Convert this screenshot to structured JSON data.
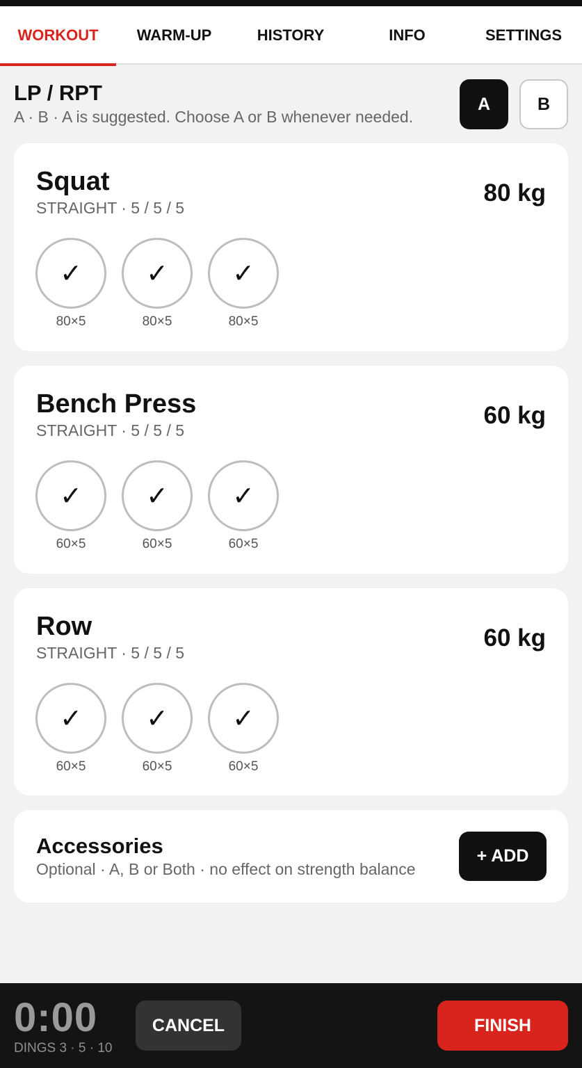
{
  "tabs": [
    {
      "label": "WORKOUT",
      "active": true
    },
    {
      "label": "WARM-UP",
      "active": false
    },
    {
      "label": "HISTORY",
      "active": false
    },
    {
      "label": "INFO",
      "active": false
    },
    {
      "label": "SETTINGS",
      "active": false
    }
  ],
  "program": {
    "title": "LP / RPT",
    "subtitle": "A · B · A is suggested. Choose A or B whenever needed.",
    "option_a": "A",
    "option_b": "B",
    "selected": "A"
  },
  "exercises": [
    {
      "name": "Squat",
      "scheme": "STRAIGHT · 5 / 5 / 5",
      "weight": "80 kg",
      "sets": [
        {
          "mark": "✓",
          "label": "80×5"
        },
        {
          "mark": "✓",
          "label": "80×5"
        },
        {
          "mark": "✓",
          "label": "80×5"
        }
      ]
    },
    {
      "name": "Bench Press",
      "scheme": "STRAIGHT · 5 / 5 / 5",
      "weight": "60 kg",
      "sets": [
        {
          "mark": "✓",
          "label": "60×5"
        },
        {
          "mark": "✓",
          "label": "60×5"
        },
        {
          "mark": "✓",
          "label": "60×5"
        }
      ]
    },
    {
      "name": "Row",
      "scheme": "STRAIGHT · 5 / 5 / 5",
      "weight": "60 kg",
      "sets": [
        {
          "mark": "✓",
          "label": "60×5"
        },
        {
          "mark": "✓",
          "label": "60×5"
        },
        {
          "mark": "✓",
          "label": "60×5"
        }
      ]
    }
  ],
  "accessories": {
    "title": "Accessories",
    "subtitle": "Optional · A, B or Both · no effect on strength balance",
    "add_label": "+ ADD"
  },
  "footer": {
    "timer": "0:00",
    "dings": "DINGS 3 · 5 · 10",
    "cancel_label": "CANCEL",
    "finish_label": "FINISH"
  },
  "colors": {
    "accent": "#d9231d",
    "dark": "#111111",
    "background": "#f2f2f2"
  }
}
